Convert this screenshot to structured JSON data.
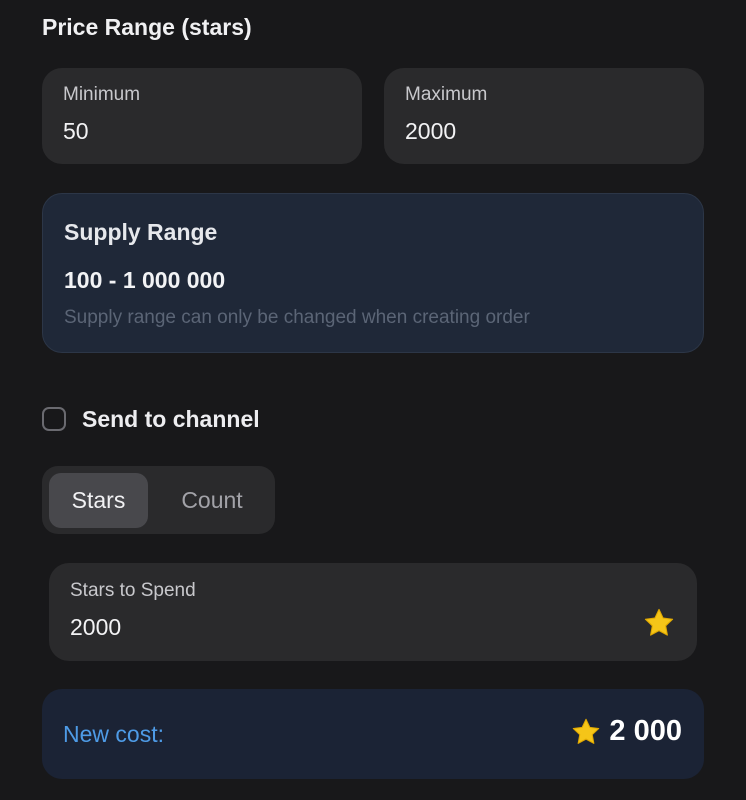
{
  "price_range": {
    "title": "Price Range (stars)",
    "minimum": {
      "label": "Minimum",
      "value": "50"
    },
    "maximum": {
      "label": "Maximum",
      "value": "2000"
    }
  },
  "supply_range": {
    "title": "Supply Range",
    "value": "100 - 1 000 000",
    "note": "Supply range can only be changed when creating order"
  },
  "send_to_channel": {
    "label": "Send to channel",
    "checked": false
  },
  "mode_toggle": {
    "options": [
      "Stars",
      "Count"
    ],
    "selected": "Stars"
  },
  "stars_to_spend": {
    "label": "Stars to Spend",
    "value": "2000",
    "icon": "star-icon"
  },
  "new_cost": {
    "label": "New cost:",
    "amount": "2 000",
    "icon": "star-icon"
  },
  "colors": {
    "background": "#18181a",
    "card": "#2a2a2c",
    "info_card": "#1f2838",
    "cost_card": "#1b2335",
    "accent_blue": "#4e9be6",
    "star_gold": "#f5c518"
  }
}
